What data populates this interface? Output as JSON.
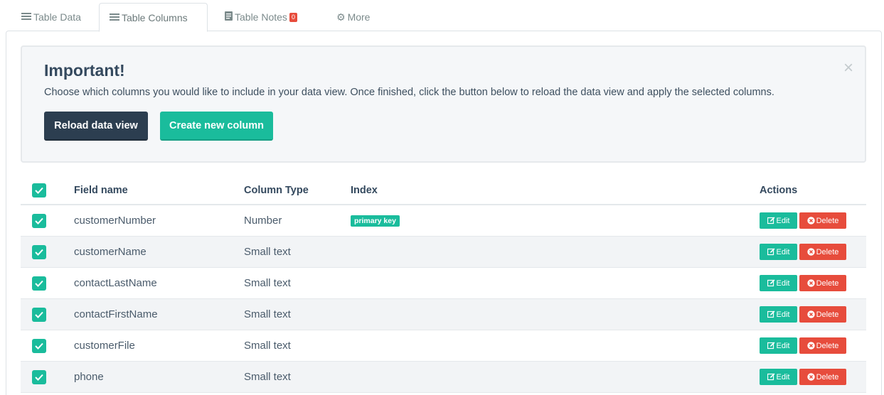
{
  "tabs": [
    {
      "label": "Table Data",
      "icon": "list-icon"
    },
    {
      "label": "Table Columns",
      "icon": "list-icon"
    },
    {
      "label": "Table Notes",
      "icon": "document-icon",
      "badge": "0"
    },
    {
      "label": "More",
      "icon": "gear-icon"
    }
  ],
  "alert": {
    "title": "Important!",
    "text": "Choose which columns you would like to include in your data view. Once finished, click the button below to reload the data view and apply the selected columns.",
    "close": "×",
    "reload_label": "Reload data view",
    "create_label": "Create new column"
  },
  "table": {
    "headers": {
      "field": "Field name",
      "type": "Column Type",
      "index": "Index",
      "actions": "Actions"
    },
    "edit_label": "Edit",
    "delete_label": "Delete",
    "rows": [
      {
        "field": "customerNumber",
        "type": "Number",
        "index": "primary key"
      },
      {
        "field": "customerName",
        "type": "Small text",
        "index": ""
      },
      {
        "field": "contactLastName",
        "type": "Small text",
        "index": ""
      },
      {
        "field": "contactFirstName",
        "type": "Small text",
        "index": ""
      },
      {
        "field": "customerFile",
        "type": "Small text",
        "index": ""
      },
      {
        "field": "phone",
        "type": "Small text",
        "index": ""
      }
    ]
  },
  "colors": {
    "accent": "#1abc9c",
    "danger": "#e74c3c",
    "dark": "#2c3e50"
  }
}
